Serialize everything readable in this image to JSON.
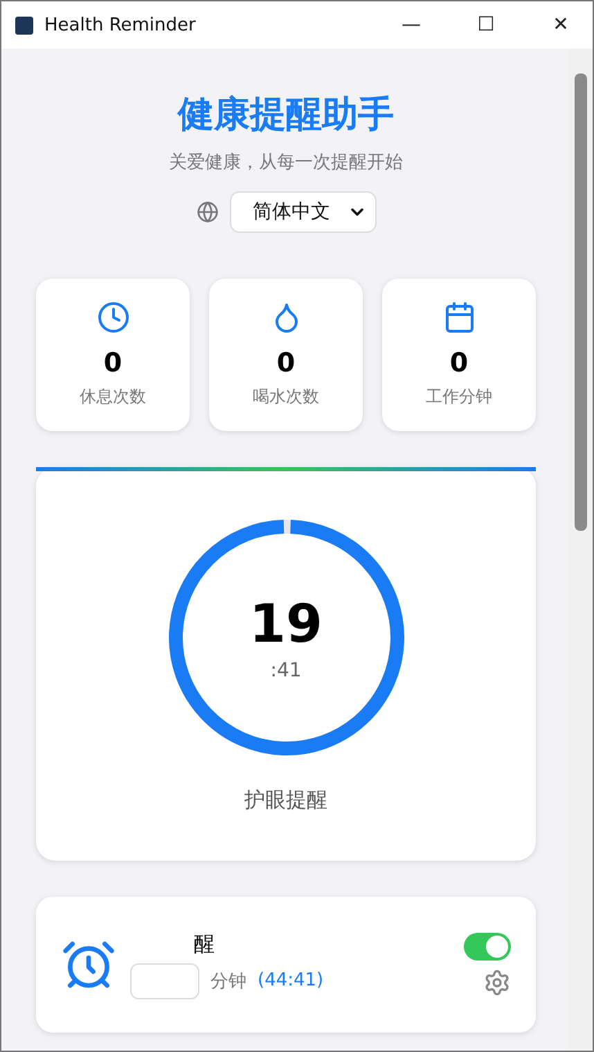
{
  "window": {
    "title": "Health Reminder",
    "controls": [
      "—",
      "☐",
      "✕"
    ]
  },
  "header": {
    "title": "健康提醒助手",
    "subtitle": "关爱健康，从每一次提醒开始",
    "language": "简体中文"
  },
  "stats": [
    {
      "value": "0",
      "label": "休息次数"
    },
    {
      "value": "0",
      "label": "喝水次数"
    },
    {
      "value": "0",
      "label": "工作分钟"
    }
  ],
  "timer": {
    "minutes": "19",
    "seconds": ":41",
    "label": "护眼提醒",
    "level": 0.99
  },
  "reminder": {
    "title": "醒",
    "unit": "分钟",
    "countdown": "(44:41)",
    "on": true
  }
}
